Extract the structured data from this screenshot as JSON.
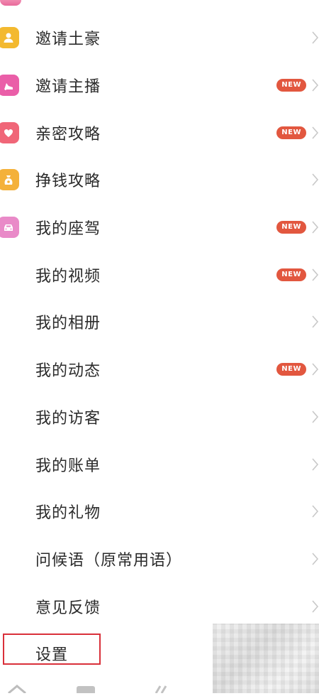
{
  "menu": {
    "items": [
      {
        "label": "邀请土豪",
        "icon": "user-icon",
        "icon_color": "#f3b92f",
        "badge": ""
      },
      {
        "label": "邀请主播",
        "icon": "high-heel-icon",
        "icon_color": "#ea5ea8",
        "badge": "NEW"
      },
      {
        "label": "亲密攻略",
        "icon": "heart-icon",
        "icon_color": "#f06678",
        "badge": "NEW"
      },
      {
        "label": "挣钱攻略",
        "icon": "money-bag-icon",
        "icon_color": "#f4b13a",
        "badge": ""
      },
      {
        "label": "我的座驾",
        "icon": "car-icon",
        "icon_color": "#e98ac8",
        "badge": "NEW"
      },
      {
        "label": "我的视频",
        "icon": "",
        "icon_color": "",
        "badge": "NEW"
      },
      {
        "label": "我的相册",
        "icon": "",
        "icon_color": "",
        "badge": ""
      },
      {
        "label": "我的动态",
        "icon": "",
        "icon_color": "",
        "badge": "NEW"
      },
      {
        "label": "我的访客",
        "icon": "",
        "icon_color": "",
        "badge": ""
      },
      {
        "label": "我的账单",
        "icon": "",
        "icon_color": "",
        "badge": ""
      },
      {
        "label": "我的礼物",
        "icon": "",
        "icon_color": "",
        "badge": ""
      },
      {
        "label": "问候语（原常用语）",
        "icon": "",
        "icon_color": "",
        "badge": ""
      },
      {
        "label": "意见反馈",
        "icon": "",
        "icon_color": "",
        "badge": ""
      },
      {
        "label": "设置",
        "icon": "",
        "icon_color": "",
        "badge": ""
      }
    ]
  },
  "colors": {
    "badge": "#e2573f",
    "highlight": "#d9303a",
    "chevron": "#c8c8c8"
  }
}
